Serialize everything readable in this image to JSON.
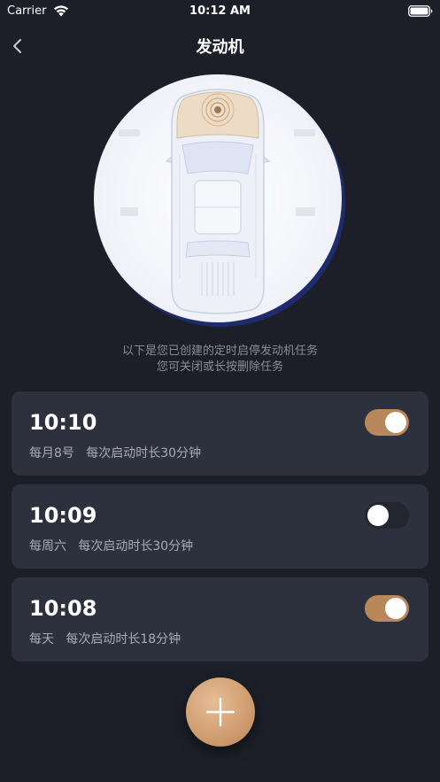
{
  "status_bar": {
    "carrier": "Carrier",
    "time": "10:12 AM",
    "wifi_icon": "wifi-icon",
    "battery_icon": "battery-icon"
  },
  "nav": {
    "title": "发动机",
    "back_icon": "chevron-left-icon"
  },
  "info": {
    "line1": "以下是您已创建的定时启停发动机任务",
    "line2": "您可关闭或长按删除任务"
  },
  "tasks": [
    {
      "time": "10:10",
      "desc": "每月8号   每次启动时长30分钟",
      "enabled": true
    },
    {
      "time": "10:09",
      "desc": "每周六   每次启动时长30分钟",
      "enabled": false
    },
    {
      "time": "10:08",
      "desc": "每天   每次启动时长18分钟",
      "enabled": true
    }
  ],
  "colors": {
    "background": "#1c1f27",
    "card": "#2d313e",
    "accent": "#b8885a",
    "subtext": "#a9acb4"
  },
  "add_button_icon": "plus-icon"
}
